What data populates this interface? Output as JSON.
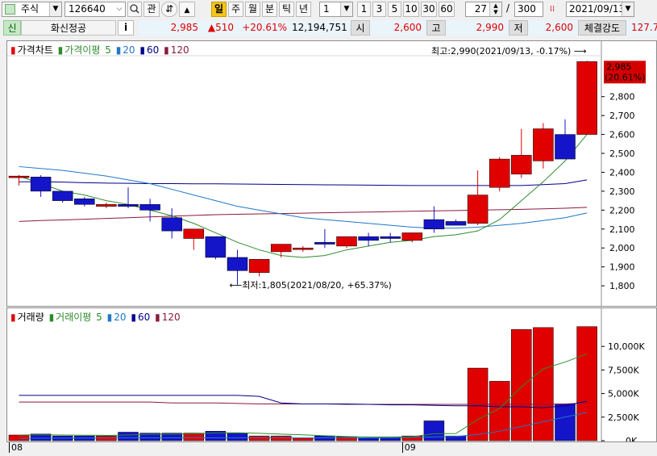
{
  "toolbar": {
    "market_select": "주식",
    "code_input": "126640",
    "btn_search_icon": "search-icon",
    "btn_gwan": "관",
    "btn_refresh_icon": "refresh-icon",
    "btn_updown_icon": "updown-icon",
    "period_tabs": [
      "일",
      "주",
      "월",
      "분",
      "틱",
      "년"
    ],
    "interval_select": "1",
    "interval_buttons": [
      "1",
      "3",
      "5",
      "10",
      "30",
      "60"
    ],
    "count_value": "27",
    "count_sep": "/",
    "count_total": "300",
    "date_value": "2021/09/13"
  },
  "quote": {
    "sin_badge": "신",
    "stock_name": "화신정공",
    "info_btn": "i",
    "price": "2,985",
    "change": "▲510",
    "change_pct": "+20.61%",
    "volume": "12,194,751",
    "open_label": "시",
    "open_value": "2,600",
    "high_label": "고",
    "high_value": "2,990",
    "low_label": "저",
    "low_value": "2,600",
    "strength_label": "체결강도",
    "strength_value": "127.7"
  },
  "price_legend": {
    "chart_label": "가격차트",
    "ma_label": "가격이평",
    "periods": [
      "5",
      "20",
      "60",
      "120"
    ]
  },
  "volume_legend": {
    "chart_label": "거래량",
    "ma_label": "거래이평",
    "periods": [
      "5",
      "20",
      "60",
      "120"
    ]
  },
  "annotations": {
    "high": "최고:2,990(2021/09/13, -0.17%)",
    "low": "최저:1,805(2021/08/20, +65.37%)",
    "current_price": "2,985",
    "current_pct": "(20.61%)"
  },
  "colors": {
    "up": "#e10000",
    "down": "#1414c8",
    "ma5": "#2e8b2e",
    "ma20": "#1e78c8",
    "ma60": "#00008b",
    "ma120": "#8b1a3a"
  },
  "chart_data": [
    {
      "type": "candlestick",
      "title": "가격차트",
      "x_labels": [
        {
          "index": 0,
          "label": "08"
        },
        {
          "index": 18,
          "label": "09"
        }
      ],
      "y_ticks": [
        1800,
        1900,
        2000,
        2100,
        2200,
        2300,
        2400,
        2500,
        2600,
        2700,
        2800
      ],
      "ylim": [
        1745,
        2995
      ],
      "candles": [
        {
          "o": 2380,
          "h": 2385,
          "l": 2330,
          "c": 2380
        },
        {
          "o": 2375,
          "h": 2385,
          "l": 2270,
          "c": 2300
        },
        {
          "o": 2300,
          "h": 2300,
          "l": 2240,
          "c": 2250
        },
        {
          "o": 2260,
          "h": 2270,
          "l": 2220,
          "c": 2230
        },
        {
          "o": 2220,
          "h": 2240,
          "l": 2210,
          "c": 2230
        },
        {
          "o": 2230,
          "h": 2320,
          "l": 2210,
          "c": 2220
        },
        {
          "o": 2230,
          "h": 2260,
          "l": 2140,
          "c": 2200
        },
        {
          "o": 2160,
          "h": 2210,
          "l": 2050,
          "c": 2090
        },
        {
          "o": 2050,
          "h": 2100,
          "l": 1990,
          "c": 2100
        },
        {
          "o": 2060,
          "h": 2060,
          "l": 1940,
          "c": 1950
        },
        {
          "o": 1950,
          "h": 1990,
          "l": 1805,
          "c": 1880
        },
        {
          "o": 1870,
          "h": 1930,
          "l": 1850,
          "c": 1940
        },
        {
          "o": 1980,
          "h": 2020,
          "l": 1950,
          "c": 2020
        },
        {
          "o": 2000,
          "h": 2010,
          "l": 1980,
          "c": 2000
        },
        {
          "o": 2030,
          "h": 2100,
          "l": 2000,
          "c": 2020
        },
        {
          "o": 2010,
          "h": 2060,
          "l": 2000,
          "c": 2060
        },
        {
          "o": 2060,
          "h": 2080,
          "l": 2010,
          "c": 2040
        },
        {
          "o": 2060,
          "h": 2080,
          "l": 2030,
          "c": 2050
        },
        {
          "o": 2040,
          "h": 2070,
          "l": 2030,
          "c": 2080
        },
        {
          "o": 2150,
          "h": 2220,
          "l": 2080,
          "c": 2100
        },
        {
          "o": 2140,
          "h": 2150,
          "l": 2120,
          "c": 2120
        },
        {
          "o": 2130,
          "h": 2410,
          "l": 2120,
          "c": 2280
        },
        {
          "o": 2320,
          "h": 2480,
          "l": 2300,
          "c": 2470
        },
        {
          "o": 2390,
          "h": 2630,
          "l": 2370,
          "c": 2490
        },
        {
          "o": 2460,
          "h": 2660,
          "l": 2420,
          "c": 2630
        },
        {
          "o": 2600,
          "h": 2680,
          "l": 2480,
          "c": 2470
        },
        {
          "o": 2600,
          "h": 2990,
          "l": 2600,
          "c": 2985
        }
      ],
      "ma5": [
        2380,
        2340,
        2300,
        2280,
        2250,
        2230,
        2200,
        2170,
        2130,
        2080,
        2030,
        1990,
        1960,
        1950,
        1960,
        1990,
        2010,
        2030,
        2040,
        2060,
        2070,
        2090,
        2150,
        2250,
        2350,
        2460,
        2600
      ],
      "ma20": [
        2430,
        2420,
        2410,
        2395,
        2380,
        2360,
        2340,
        2310,
        2280,
        2250,
        2220,
        2200,
        2180,
        2160,
        2150,
        2140,
        2130,
        2120,
        2110,
        2105,
        2105,
        2110,
        2120,
        2130,
        2145,
        2160,
        2185
      ],
      "ma60": [
        2350,
        2350,
        2348,
        2345,
        2343,
        2342,
        2340,
        2340,
        2339,
        2339,
        2338,
        2337,
        2336,
        2335,
        2334,
        2333,
        2332,
        2331,
        2330,
        2330,
        2330,
        2330,
        2330,
        2330,
        2335,
        2340,
        2360
      ],
      "ma120": [
        2140,
        2145,
        2148,
        2152,
        2156,
        2160,
        2164,
        2168,
        2172,
        2176,
        2178,
        2180,
        2182,
        2184,
        2186,
        2188,
        2190,
        2192,
        2194,
        2196,
        2198,
        2200,
        2202,
        2204,
        2207,
        2210,
        2215
      ]
    },
    {
      "type": "bar",
      "title": "거래량",
      "y_ticks": [
        0,
        2500,
        5000,
        7500,
        10000
      ],
      "y_tick_labels": [
        "0K",
        "2,500K",
        "5,000K",
        "7,500K",
        "10,000K"
      ],
      "ylim": [
        0,
        12500
      ],
      "values": [
        600,
        700,
        500,
        500,
        500,
        900,
        800,
        800,
        800,
        1000,
        800,
        500,
        500,
        300,
        500,
        400,
        300,
        400,
        500,
        2100,
        500,
        7700,
        6300,
        11800,
        12000,
        3900,
        12100
      ],
      "ma5": [
        600,
        620,
        600,
        580,
        560,
        600,
        680,
        700,
        720,
        820,
        830,
        780,
        700,
        620,
        520,
        440,
        400,
        380,
        420,
        740,
        760,
        2240,
        3420,
        5700,
        7620,
        8340,
        9200
      ],
      "ma20": [
        4800,
        4800,
        4800,
        4800,
        4800,
        4800,
        4800,
        4800,
        4800,
        4800,
        4800,
        4700,
        4000,
        3900,
        3900,
        3900,
        3850,
        3800,
        3800,
        3750,
        3700,
        3700,
        3600,
        3600,
        3500,
        3700,
        4200
      ],
      "ma60": [
        4100,
        4100,
        4100,
        4100,
        4100,
        4100,
        4100,
        4000,
        4000,
        4000,
        3950,
        3900,
        3900,
        3900,
        3900,
        3850,
        3850,
        3850,
        3850,
        3850,
        3850,
        3850,
        3850,
        3850,
        3850,
        3900,
        4000
      ],
      "ma120": [
        250,
        260,
        270,
        280,
        290,
        300,
        300,
        300,
        300,
        300,
        300,
        300,
        300,
        300,
        300,
        300,
        300,
        300,
        350,
        400,
        450,
        650,
        1000,
        1500,
        2000,
        2500,
        3000
      ]
    }
  ]
}
